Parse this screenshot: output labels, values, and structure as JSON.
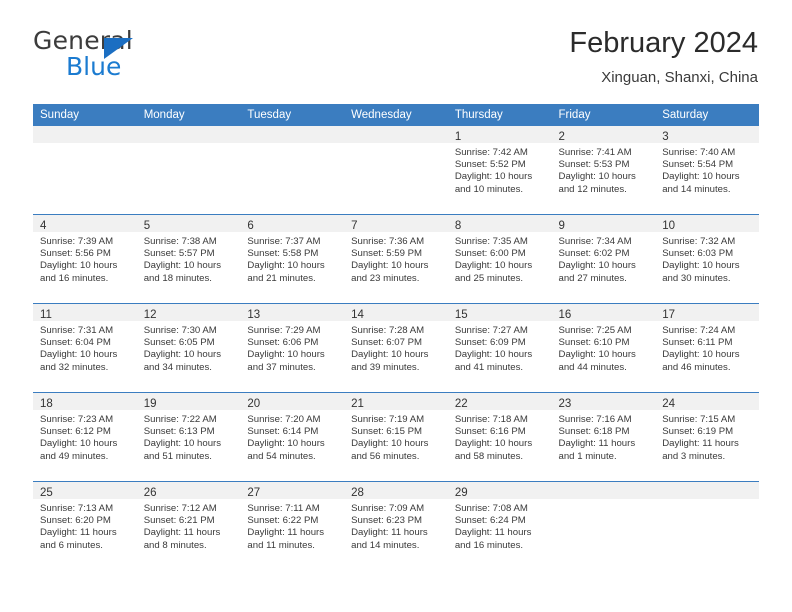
{
  "logo": {
    "word1": "General",
    "word2": "Blue",
    "triangle_color": "#1b6ec2",
    "word2_color": "#1b7bd0"
  },
  "header": {
    "title": "February 2024",
    "subtitle": "Xinguan, Shanxi, China",
    "accent_color": "#3b7dc0"
  },
  "weekday_headers": [
    "Sunday",
    "Monday",
    "Tuesday",
    "Wednesday",
    "Thursday",
    "Friday",
    "Saturday"
  ],
  "labels": {
    "sunrise": "Sunrise:",
    "sunset": "Sunset:",
    "daylight": "Daylight:"
  },
  "weeks": [
    [
      {
        "day": ""
      },
      {
        "day": ""
      },
      {
        "day": ""
      },
      {
        "day": ""
      },
      {
        "day": "1",
        "sunrise": "Sunrise: 7:42 AM",
        "sunset": "Sunset: 5:52 PM",
        "daylight": "Daylight: 10 hours and 10 minutes."
      },
      {
        "day": "2",
        "sunrise": "Sunrise: 7:41 AM",
        "sunset": "Sunset: 5:53 PM",
        "daylight": "Daylight: 10 hours and 12 minutes."
      },
      {
        "day": "3",
        "sunrise": "Sunrise: 7:40 AM",
        "sunset": "Sunset: 5:54 PM",
        "daylight": "Daylight: 10 hours and 14 minutes."
      }
    ],
    [
      {
        "day": "4",
        "sunrise": "Sunrise: 7:39 AM",
        "sunset": "Sunset: 5:56 PM",
        "daylight": "Daylight: 10 hours and 16 minutes."
      },
      {
        "day": "5",
        "sunrise": "Sunrise: 7:38 AM",
        "sunset": "Sunset: 5:57 PM",
        "daylight": "Daylight: 10 hours and 18 minutes."
      },
      {
        "day": "6",
        "sunrise": "Sunrise: 7:37 AM",
        "sunset": "Sunset: 5:58 PM",
        "daylight": "Daylight: 10 hours and 21 minutes."
      },
      {
        "day": "7",
        "sunrise": "Sunrise: 7:36 AM",
        "sunset": "Sunset: 5:59 PM",
        "daylight": "Daylight: 10 hours and 23 minutes."
      },
      {
        "day": "8",
        "sunrise": "Sunrise: 7:35 AM",
        "sunset": "Sunset: 6:00 PM",
        "daylight": "Daylight: 10 hours and 25 minutes."
      },
      {
        "day": "9",
        "sunrise": "Sunrise: 7:34 AM",
        "sunset": "Sunset: 6:02 PM",
        "daylight": "Daylight: 10 hours and 27 minutes."
      },
      {
        "day": "10",
        "sunrise": "Sunrise: 7:32 AM",
        "sunset": "Sunset: 6:03 PM",
        "daylight": "Daylight: 10 hours and 30 minutes."
      }
    ],
    [
      {
        "day": "11",
        "sunrise": "Sunrise: 7:31 AM",
        "sunset": "Sunset: 6:04 PM",
        "daylight": "Daylight: 10 hours and 32 minutes."
      },
      {
        "day": "12",
        "sunrise": "Sunrise: 7:30 AM",
        "sunset": "Sunset: 6:05 PM",
        "daylight": "Daylight: 10 hours and 34 minutes."
      },
      {
        "day": "13",
        "sunrise": "Sunrise: 7:29 AM",
        "sunset": "Sunset: 6:06 PM",
        "daylight": "Daylight: 10 hours and 37 minutes."
      },
      {
        "day": "14",
        "sunrise": "Sunrise: 7:28 AM",
        "sunset": "Sunset: 6:07 PM",
        "daylight": "Daylight: 10 hours and 39 minutes."
      },
      {
        "day": "15",
        "sunrise": "Sunrise: 7:27 AM",
        "sunset": "Sunset: 6:09 PM",
        "daylight": "Daylight: 10 hours and 41 minutes."
      },
      {
        "day": "16",
        "sunrise": "Sunrise: 7:25 AM",
        "sunset": "Sunset: 6:10 PM",
        "daylight": "Daylight: 10 hours and 44 minutes."
      },
      {
        "day": "17",
        "sunrise": "Sunrise: 7:24 AM",
        "sunset": "Sunset: 6:11 PM",
        "daylight": "Daylight: 10 hours and 46 minutes."
      }
    ],
    [
      {
        "day": "18",
        "sunrise": "Sunrise: 7:23 AM",
        "sunset": "Sunset: 6:12 PM",
        "daylight": "Daylight: 10 hours and 49 minutes."
      },
      {
        "day": "19",
        "sunrise": "Sunrise: 7:22 AM",
        "sunset": "Sunset: 6:13 PM",
        "daylight": "Daylight: 10 hours and 51 minutes."
      },
      {
        "day": "20",
        "sunrise": "Sunrise: 7:20 AM",
        "sunset": "Sunset: 6:14 PM",
        "daylight": "Daylight: 10 hours and 54 minutes."
      },
      {
        "day": "21",
        "sunrise": "Sunrise: 7:19 AM",
        "sunset": "Sunset: 6:15 PM",
        "daylight": "Daylight: 10 hours and 56 minutes."
      },
      {
        "day": "22",
        "sunrise": "Sunrise: 7:18 AM",
        "sunset": "Sunset: 6:16 PM",
        "daylight": "Daylight: 10 hours and 58 minutes."
      },
      {
        "day": "23",
        "sunrise": "Sunrise: 7:16 AM",
        "sunset": "Sunset: 6:18 PM",
        "daylight": "Daylight: 11 hours and 1 minute."
      },
      {
        "day": "24",
        "sunrise": "Sunrise: 7:15 AM",
        "sunset": "Sunset: 6:19 PM",
        "daylight": "Daylight: 11 hours and 3 minutes."
      }
    ],
    [
      {
        "day": "25",
        "sunrise": "Sunrise: 7:13 AM",
        "sunset": "Sunset: 6:20 PM",
        "daylight": "Daylight: 11 hours and 6 minutes."
      },
      {
        "day": "26",
        "sunrise": "Sunrise: 7:12 AM",
        "sunset": "Sunset: 6:21 PM",
        "daylight": "Daylight: 11 hours and 8 minutes."
      },
      {
        "day": "27",
        "sunrise": "Sunrise: 7:11 AM",
        "sunset": "Sunset: 6:22 PM",
        "daylight": "Daylight: 11 hours and 11 minutes."
      },
      {
        "day": "28",
        "sunrise": "Sunrise: 7:09 AM",
        "sunset": "Sunset: 6:23 PM",
        "daylight": "Daylight: 11 hours and 14 minutes."
      },
      {
        "day": "29",
        "sunrise": "Sunrise: 7:08 AM",
        "sunset": "Sunset: 6:24 PM",
        "daylight": "Daylight: 11 hours and 16 minutes."
      },
      {
        "day": ""
      },
      {
        "day": ""
      }
    ]
  ]
}
